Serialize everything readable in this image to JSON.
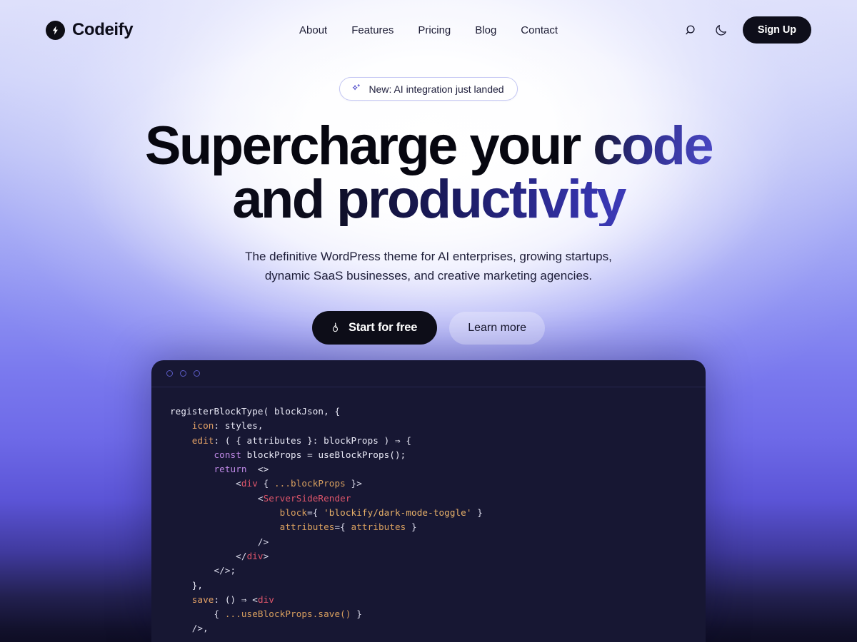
{
  "brand": {
    "name": "Codeify",
    "logo_icon": "lightning-bolt-icon"
  },
  "nav": {
    "items": [
      {
        "label": "About"
      },
      {
        "label": "Features"
      },
      {
        "label": "Pricing"
      },
      {
        "label": "Blog"
      },
      {
        "label": "Contact"
      }
    ]
  },
  "header_actions": {
    "search_icon": "search-icon",
    "theme_icon": "moon-icon",
    "signup_label": "Sign Up"
  },
  "hero": {
    "badge": {
      "icon": "sparkle-icon",
      "text": "New: AI integration just landed"
    },
    "headline_line1_plain": "Supercharge your ",
    "headline_line1_accent": "code",
    "headline_line2": "and productivity",
    "subtitle_line1": "The definitive WordPress theme for AI enterprises, growing startups,",
    "subtitle_line2": "dynamic SaaS businesses, and creative marketing agencies.",
    "cta_primary": {
      "label": "Start for free",
      "icon": "flame-icon"
    },
    "cta_secondary": {
      "label": "Learn more"
    }
  },
  "code_window": {
    "dots": [
      "window-dot-1",
      "window-dot-2",
      "window-dot-3"
    ],
    "language": "jsx",
    "lines": [
      [
        {
          "t": "registerBlockType( blockJson, {",
          "c": "plain"
        }
      ],
      [
        {
          "t": "    ",
          "c": "plain"
        },
        {
          "t": "icon",
          "c": "prop"
        },
        {
          "t": ": styles,",
          "c": "plain"
        }
      ],
      [
        {
          "t": "    ",
          "c": "plain"
        },
        {
          "t": "edit",
          "c": "prop"
        },
        {
          "t": ": ( { attributes }: blockProps ) ⇒ {",
          "c": "plain"
        }
      ],
      [
        {
          "t": "        ",
          "c": "plain"
        },
        {
          "t": "const",
          "c": "key"
        },
        {
          "t": " blockProps = useBlockProps();",
          "c": "plain"
        }
      ],
      [
        {
          "t": "        ",
          "c": "plain"
        },
        {
          "t": "return",
          "c": "key"
        },
        {
          "t": "  <>",
          "c": "plain"
        }
      ],
      [
        {
          "t": "            <",
          "c": "punc"
        },
        {
          "t": "div",
          "c": "tag"
        },
        {
          "t": " { ",
          "c": "punc"
        },
        {
          "t": "...blockProps",
          "c": "attr"
        },
        {
          "t": " }>",
          "c": "punc"
        }
      ],
      [
        {
          "t": "                <",
          "c": "punc"
        },
        {
          "t": "ServerSideRender",
          "c": "tag"
        }
      ],
      [
        {
          "t": "                    ",
          "c": "plain"
        },
        {
          "t": "block",
          "c": "attr"
        },
        {
          "t": "={ ",
          "c": "punc"
        },
        {
          "t": "'blockify/dark-mode-toggle'",
          "c": "str"
        },
        {
          "t": " }",
          "c": "punc"
        }
      ],
      [
        {
          "t": "                    ",
          "c": "plain"
        },
        {
          "t": "attributes",
          "c": "attr"
        },
        {
          "t": "={ ",
          "c": "punc"
        },
        {
          "t": "attributes",
          "c": "attr"
        },
        {
          "t": " }",
          "c": "punc"
        }
      ],
      [
        {
          "t": "                />",
          "c": "punc"
        }
      ],
      [
        {
          "t": "            </",
          "c": "punc"
        },
        {
          "t": "div",
          "c": "tag"
        },
        {
          "t": ">",
          "c": "punc"
        }
      ],
      [
        {
          "t": "        </>;",
          "c": "punc"
        }
      ],
      [
        {
          "t": "    },",
          "c": "plain"
        }
      ],
      [
        {
          "t": "    ",
          "c": "plain"
        },
        {
          "t": "save",
          "c": "prop"
        },
        {
          "t": ": () ⇒ <",
          "c": "plain"
        },
        {
          "t": "div",
          "c": "tag"
        }
      ],
      [
        {
          "t": "        { ",
          "c": "punc"
        },
        {
          "t": "...useBlockProps.save()",
          "c": "attr"
        },
        {
          "t": " }",
          "c": "punc"
        }
      ],
      [
        {
          "t": "    />,",
          "c": "punc"
        }
      ]
    ]
  },
  "colors": {
    "accent_indigo": "#4f4cd2",
    "ink": "#070710",
    "badge_border": "#c3c6f3",
    "code_bg": "#171733",
    "bg_top": "#dfe1fb",
    "bg_bottom": "#0e0d24"
  }
}
